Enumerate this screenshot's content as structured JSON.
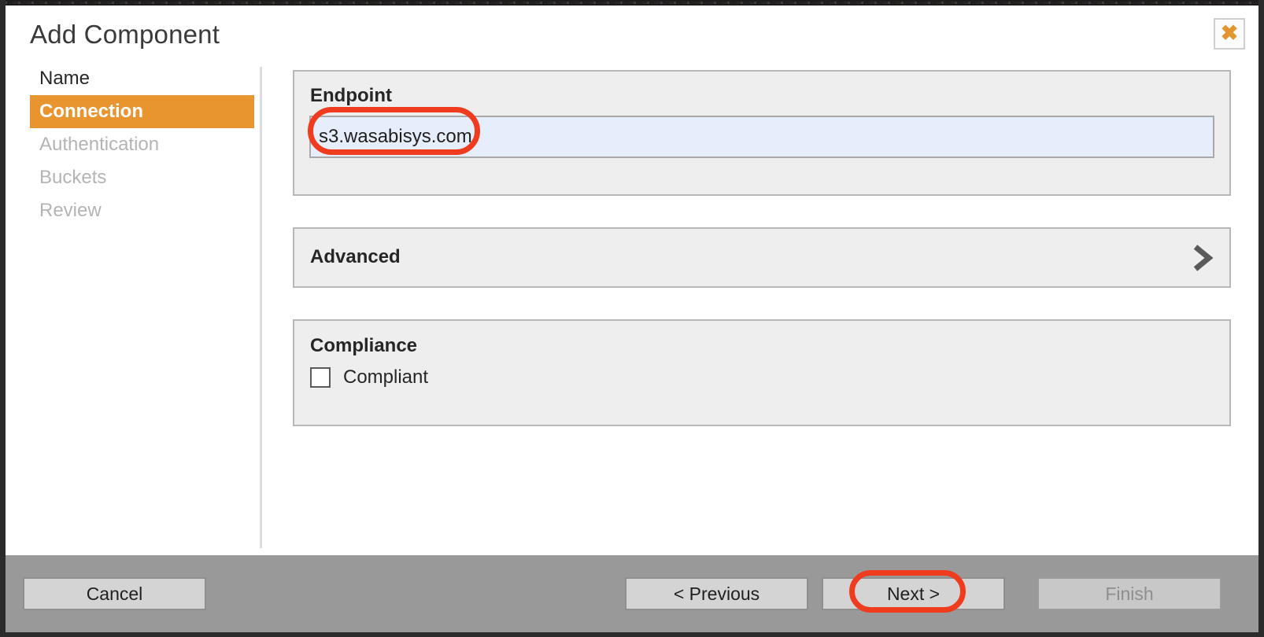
{
  "dialog": {
    "title": "Add Component",
    "close_icon": "close-x-icon",
    "accent_color": "#e8952f",
    "annotation_color": "#ef3b1e"
  },
  "steps": [
    {
      "label": "Name",
      "state": "done"
    },
    {
      "label": "Connection",
      "state": "active"
    },
    {
      "label": "Authentication",
      "state": "upcoming"
    },
    {
      "label": "Buckets",
      "state": "upcoming"
    },
    {
      "label": "Review",
      "state": "upcoming"
    }
  ],
  "endpoint": {
    "heading": "Endpoint",
    "value": "s3.wasabisys.com",
    "placeholder": "",
    "field_bg": "#e7eefb",
    "annotated": true
  },
  "advanced": {
    "heading": "Advanced",
    "expand_icon": "chevron-right-icon",
    "expanded": false
  },
  "compliance": {
    "heading": "Compliance",
    "checkbox_label": "Compliant",
    "checked": false
  },
  "footer": {
    "cancel_label": "Cancel",
    "previous_label": "< Previous",
    "next_label": "Next >",
    "finish_label": "Finish",
    "finish_disabled": true,
    "next_annotated": true,
    "background": "#999999"
  }
}
